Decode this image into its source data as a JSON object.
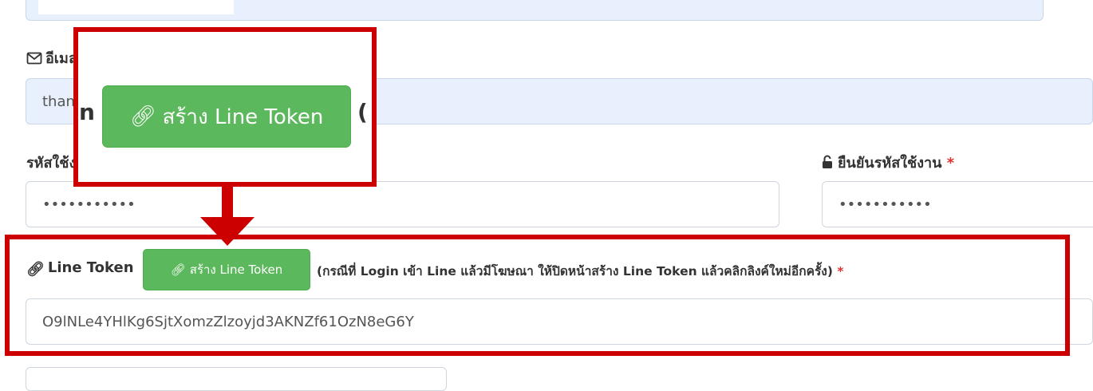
{
  "email_label": "อีเมล",
  "email_value": "thanachai@example.com",
  "password_label": "รหัสใช้งาน",
  "password_value": "•••••••••••",
  "confirm_password_label": "ยืนยันรหัสใช้งาน",
  "confirm_password_value": "•••••••••••",
  "required_mark": "*",
  "line_token": {
    "label": "Line Token",
    "button_label": "สร้าง Line Token",
    "note": "(กรณีที่ Login เข้า Line แล้วมีโฆษณา ให้ปิดหน้าสร้าง Line Token แล้วคลิกลิงค์ใหม่อีกครั้ง)",
    "value": "O9lNLe4YHlKg6SjtXomzZlzoyjd3AKNZf61OzN8eG6Y"
  },
  "zoom": {
    "label_fragment": "n",
    "button_label": "สร้าง Line Token",
    "paren_fragment": "("
  },
  "colors": {
    "highlight": "#cc0000",
    "button": "#5cb85c",
    "required": "#e03131"
  },
  "icons": [
    "envelope-icon",
    "link-icon",
    "unlock-icon"
  ]
}
